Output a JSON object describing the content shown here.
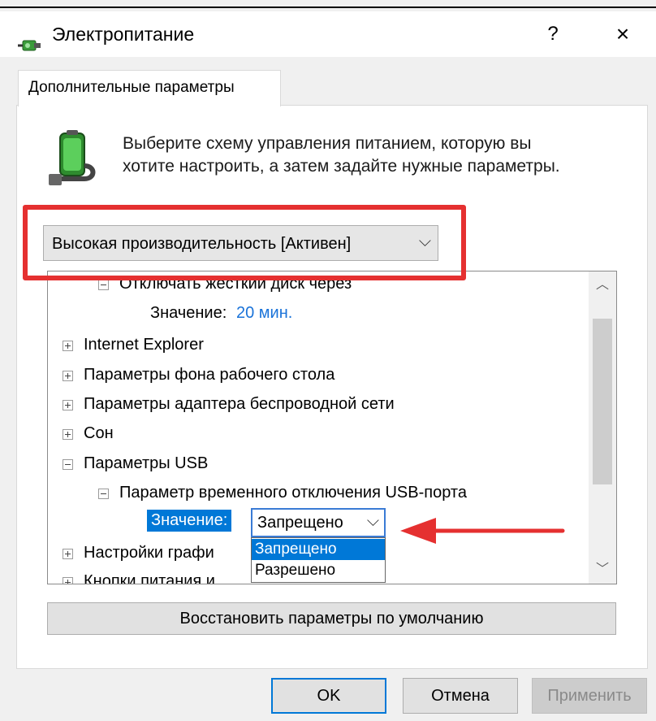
{
  "window": {
    "title": "Электропитание",
    "help": "?",
    "close": "×"
  },
  "tab": {
    "label": "Дополнительные параметры"
  },
  "description": {
    "line1": "Выберите схему управления питанием, которую вы",
    "line2": "хотите настроить, а затем задайте нужные параметры."
  },
  "scheme": {
    "selected": "Высокая производительность [Активен]"
  },
  "tree": {
    "items": [
      {
        "label": "Отключать жесткий диск через"
      },
      {
        "label": "Значение:",
        "value": "20 мин."
      },
      {
        "label": "Internet Explorer"
      },
      {
        "label": "Параметры фона рабочего стола"
      },
      {
        "label": "Параметры адаптера беспроводной сети"
      },
      {
        "label": "Сон"
      },
      {
        "label": "Параметры USB"
      },
      {
        "label": "Параметр временного отключения USB-порта"
      },
      {
        "label": "Значение:"
      },
      {
        "label": "Настройки графи"
      },
      {
        "label": "Кнопки питания и"
      }
    ],
    "value_combo": {
      "selected": "Запрещено"
    },
    "dropdown_options": [
      "Запрещено",
      "Разрешено"
    ]
  },
  "buttons": {
    "restore": "Восстановить параметры по умолчанию",
    "ok": "OK",
    "cancel": "Отмена",
    "apply": "Применить"
  },
  "colors": {
    "accent": "#0078d7",
    "highlight_red": "#e53030",
    "value_blue": "#1a73d9"
  },
  "icons": {
    "title": "power-plug-icon",
    "panel": "battery-power-icon"
  }
}
